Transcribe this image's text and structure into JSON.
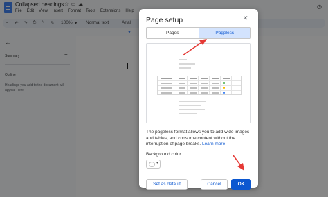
{
  "app": {
    "doc_title": "Collapsed headings",
    "menu": [
      "File",
      "Edit",
      "View",
      "Insert",
      "Format",
      "Tools",
      "Extensions",
      "Help"
    ],
    "toolbar": {
      "zoom": "100%",
      "style": "Normal text",
      "font": "Arial"
    }
  },
  "sidebar": {
    "summary_label": "Summary",
    "outline_label": "Outline",
    "outline_hint": "Headings you add to the document will appear here."
  },
  "dialog": {
    "title": "Page setup",
    "tabs": [
      {
        "label": "Pages",
        "selected": false
      },
      {
        "label": "Pageless",
        "selected": true
      }
    ],
    "description": "The pageless format allows you to add wide images and tables, and consume content without the interruption of page breaks.",
    "learn_more": "Learn more",
    "background_color_label": "Background color",
    "background_color_value": "#ffffff",
    "buttons": {
      "set_default": "Set as default",
      "cancel": "Cancel",
      "ok": "OK"
    }
  },
  "colors": {
    "accent": "#0b57d0",
    "selected_tab_bg": "#d3e3fd",
    "annotation_arrow": "#e53935"
  },
  "icons": [
    "docs-logo-icon",
    "star-icon",
    "move-folder-icon",
    "cloud-icon",
    "history-icon",
    "undo-icon",
    "redo-icon",
    "print-icon",
    "spellcheck-icon",
    "paint-format-icon",
    "back-arrow-icon",
    "add-icon",
    "close-icon",
    "chevron-down-icon"
  ]
}
